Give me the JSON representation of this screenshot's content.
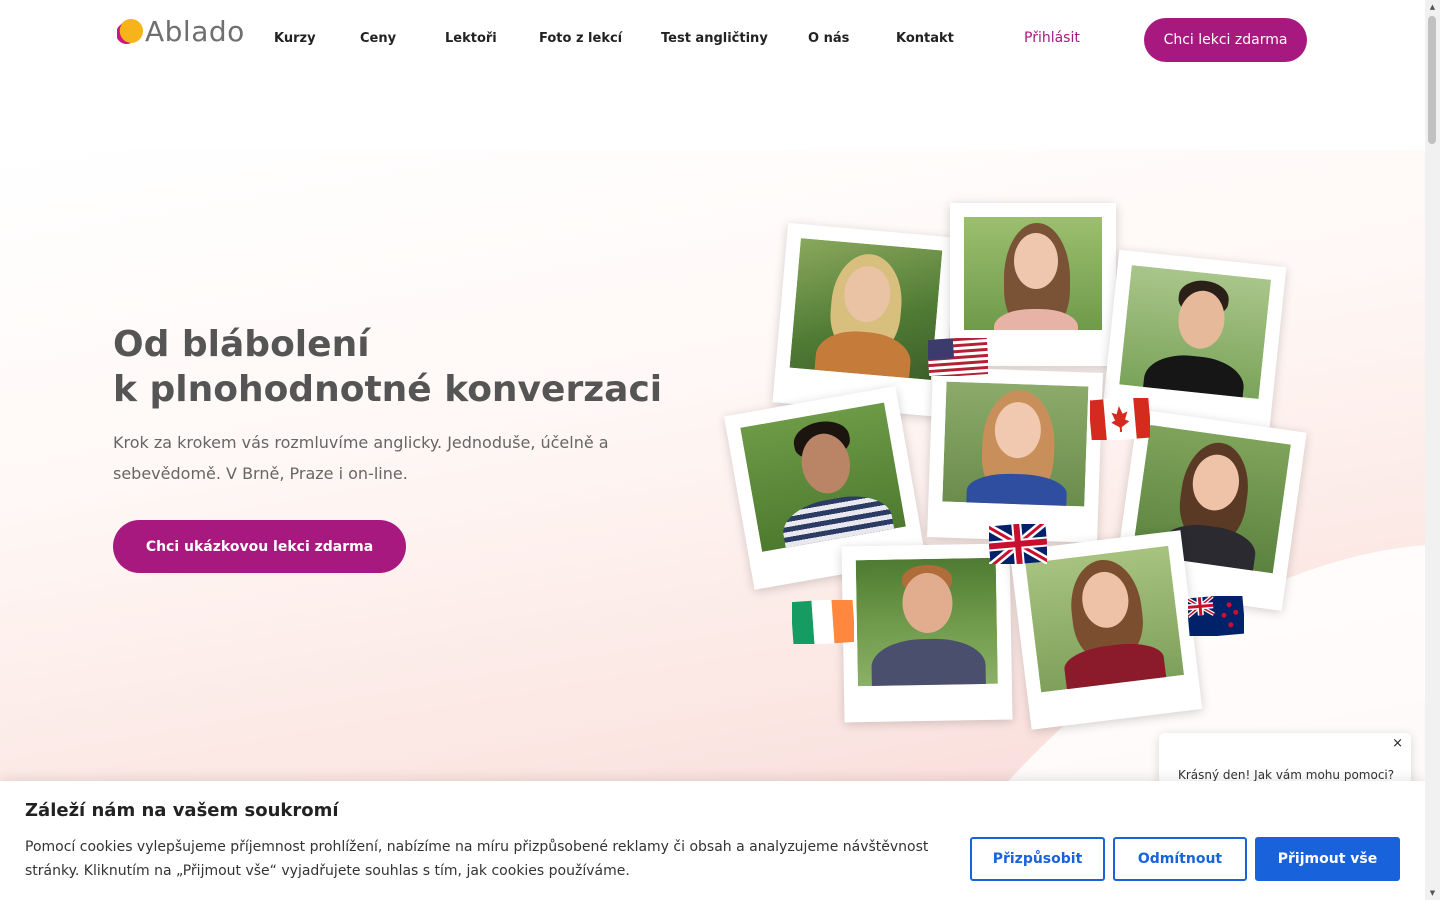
{
  "header": {
    "logo_text": "Ablado",
    "nav": [
      "Kurzy",
      "Ceny",
      "Lektoři",
      "Foto z lekcí",
      "Test angličtiny",
      "O nás",
      "Kontakt"
    ],
    "login": "Přihlásit",
    "cta": "Chci lekci zdarma"
  },
  "hero": {
    "title_line1": "Od blábolení",
    "title_line2": "k plnohodnotné konverzaci",
    "subtitle": "Krok za krokem vás rozmluvíme anglicky. Jednoduše, účelně a sebevědomě. V Brně, Praze i on-line.",
    "cta": "Chci ukázkovou lekci zdarma"
  },
  "chat": {
    "close": "×",
    "message": "Krásný den! Jak vám mohu pomoci?"
  },
  "cookie": {
    "title": "Záleží nám na vašem soukromí",
    "text": "Pomocí cookies vylepšujeme příjemnost prohlížení, nabízíme na míru přizpůsobené reklamy či obsah a analyzujeme návštěvnost stránky. Kliknutím na „Přijmout vše“ vyjadřujete souhlas s tím, jak cookies používáme.",
    "customize": "Přizpůsobit",
    "reject": "Odmítnout",
    "accept": "Přijmout vše"
  },
  "colors": {
    "brand": "#a8197f",
    "cookie_accent": "#1863dc"
  },
  "icons": [
    "logo-mark-icon",
    "close-icon",
    "flag-usa-icon",
    "flag-canada-icon",
    "flag-uk-icon",
    "flag-ireland-icon",
    "flag-new-zealand-icon"
  ]
}
